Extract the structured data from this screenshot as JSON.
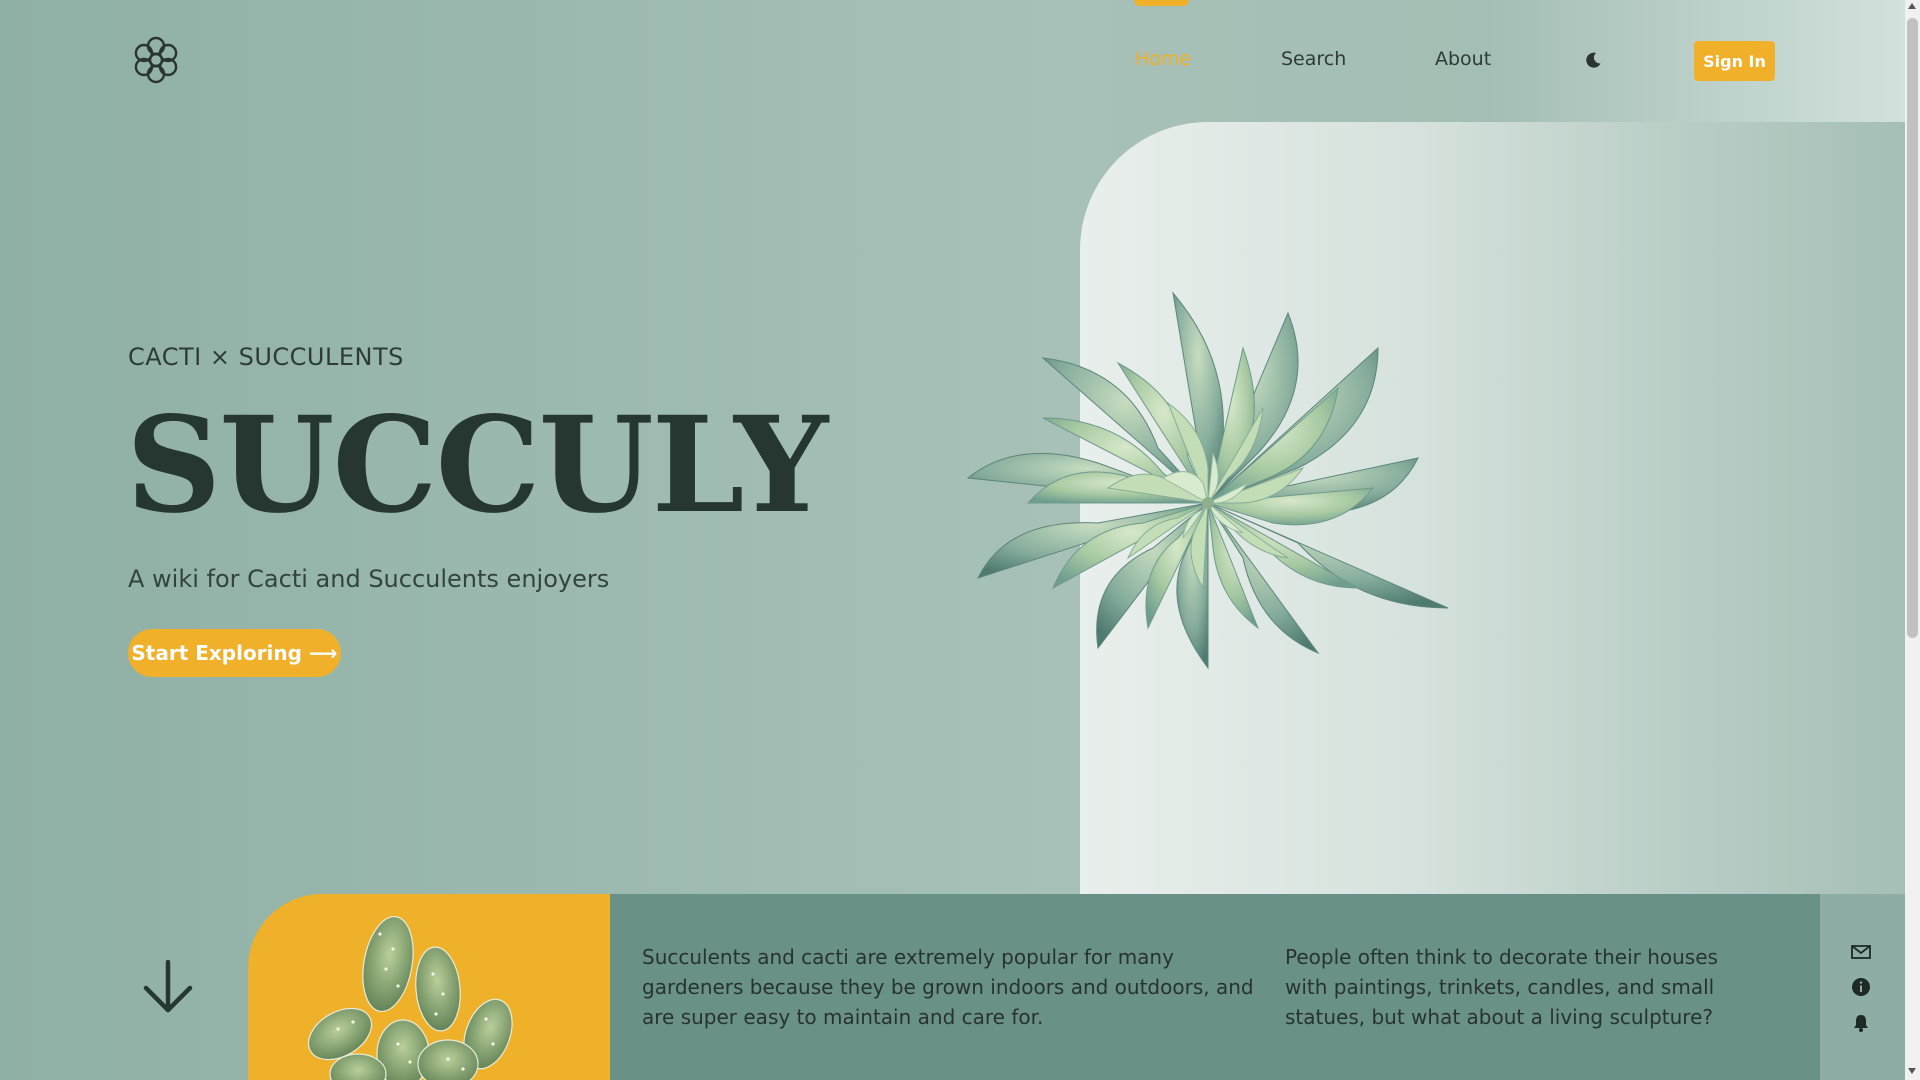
{
  "header": {
    "nav": {
      "home": "Home",
      "search": "Search",
      "about": "About"
    },
    "sign_in": "Sign In",
    "icons": [
      "flower-logo-icon",
      "moon-icon"
    ]
  },
  "hero": {
    "eyebrow": "CACTI × SUCCULENTS",
    "title": "SUCCULY",
    "subtitle": "A wiki for Cacti and Succulents enjoyers",
    "cta": "Start Exploring ⟶"
  },
  "info": {
    "paragraph_1": "Succulents and cacti are extremely popular for many gardeners because they be grown indoors and outdoors, and are super easy to maintain and care for.",
    "paragraph_2": "People often think to decorate their houses with paintings, trinkets, candles, and small statues, but what about a living sculpture?"
  },
  "side_icons": [
    "mail-icon",
    "info-icon",
    "bell-icon"
  ],
  "colors": {
    "accent": "#f0b02a",
    "teal": "#6a9188",
    "text_dark": "#263631"
  }
}
